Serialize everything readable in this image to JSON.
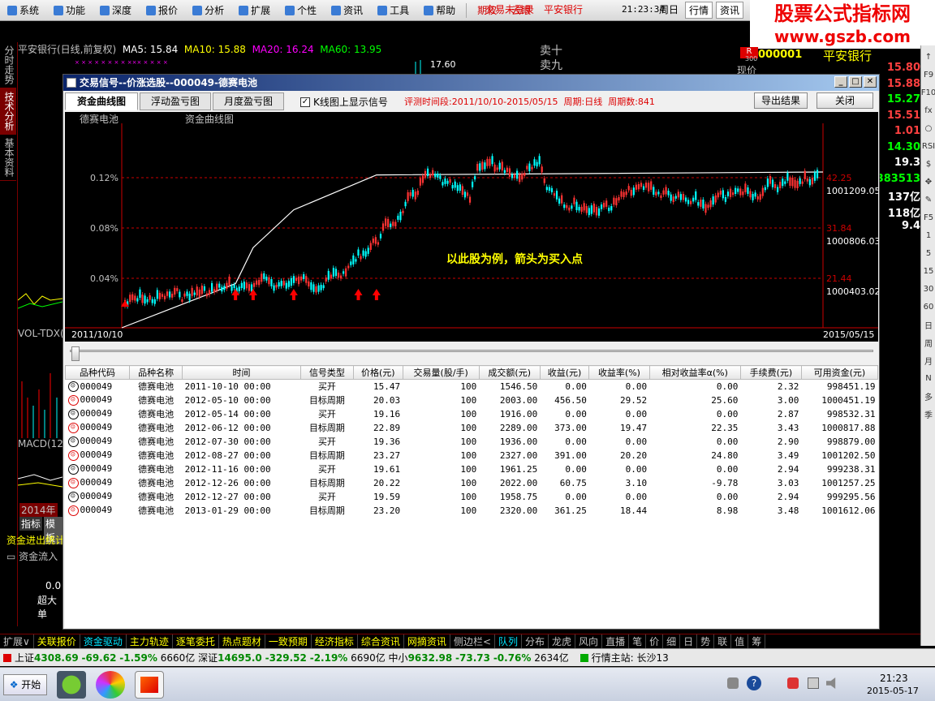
{
  "menu": {
    "items": [
      "系统",
      "功能",
      "深度",
      "报价",
      "分析",
      "扩展",
      "个性",
      "资讯",
      "工具",
      "帮助"
    ],
    "extra": [
      "期权",
      "云眼"
    ],
    "login": "交易未登录",
    "stock": "平安银行",
    "time": "21:23:34",
    "weekday": "周日",
    "btn1": "行情",
    "btn2": "资讯"
  },
  "logo": {
    "line1": "股票公式指标网",
    "line2": "www.gszb.com"
  },
  "left_tabs": [
    "分时走势",
    "技术分析",
    "基本资料"
  ],
  "bg": {
    "stock_line": "平安银行(日线,前复权)",
    "ma5": "MA5: 15.84",
    "ma10": "MA10: 15.88",
    "ma20": "MA20: 16.24",
    "ma60": "MA60: 13.95",
    "price_tag": "17.60",
    "sell10": "卖十",
    "sell9": "卖九",
    "vol_label": "VOL-TDX(",
    "macd_label": "MACD(12",
    "year_label": "2014年",
    "btab1": "指标",
    "btab2": "模板",
    "flow_title": "资金进出统计",
    "flow_sub": "资金流入",
    "flow_val": "0.0",
    "flow_cat": "超大单"
  },
  "right_panel": {
    "code_prefix": "R",
    "code_sub": "300",
    "code": "000001",
    "name": "平安银行",
    "row_top": "现价",
    "values": [
      "15.80",
      "15.88",
      "15.27",
      "15.51",
      "1.01",
      "14.30",
      "19.3",
      "383513",
      "137亿",
      "118亿",
      "9.4"
    ]
  },
  "right_toolbar": [
    "↑",
    "F9",
    "F10",
    "fx",
    "○",
    "RSI",
    "$",
    "✥",
    "✎",
    "F5",
    "1",
    "5",
    "15",
    "30",
    "60",
    "日",
    "周",
    "月",
    "N",
    "多",
    "季"
  ],
  "dialog": {
    "title": "交易信号--价涨选股--000049-德赛电池",
    "tabs": [
      "资金曲线图",
      "浮动盈亏图",
      "月度盈亏图"
    ],
    "checkbox_label": "K线图上显示信号",
    "eval_period": "评测时间段:2011/10/10-2015/05/15",
    "period": "周期:日线",
    "period_count": "周期数:841",
    "export_btn": "导出结果",
    "close_btn": "关闭"
  },
  "chart_data": {
    "type": "line",
    "stock_label": "德赛电池",
    "chart_label": "资金曲线图",
    "annotation": "以此股为例，箭头为买入点",
    "x_start": "2011/10/10",
    "x_end": "2015/05/15",
    "left_ticks": [
      "0.12%",
      "0.08%",
      "0.04%"
    ],
    "right_price_ticks": [
      "42.25",
      "31.84",
      "21.44"
    ],
    "right_fund_ticks": [
      "1001209.05",
      "1000806.03",
      "1000403.02"
    ],
    "equity_curve": {
      "name": "资金曲线",
      "x": [
        "2011/10/10",
        "2012/05/10",
        "2012/06/12",
        "2012/08/27",
        "2013/01/29",
        "2015/05/15"
      ],
      "y": [
        1000000,
        1000456.5,
        1000829.5,
        1001220.5,
        1001581.75,
        1001612.06
      ]
    },
    "buy_arrows": [
      "2012/05/10",
      "2012/06/12",
      "2012/08/27",
      "2012/12/26",
      "2013/01/29"
    ]
  },
  "table": {
    "headers": [
      "品种代码",
      "品种名称",
      "时间",
      "信号类型",
      "价格(元)",
      "交易量(股/手)",
      "成交额(元)",
      "收益(元)",
      "收益率(%)",
      "相对收益率α(%)",
      "手续费(元)",
      "可用资金(元)"
    ],
    "rows": [
      {
        "code": "000049",
        "name": "德赛电池",
        "time": "2011-10-10 00:00",
        "type": "买开",
        "price": "15.47",
        "vol": "100",
        "amount": "1546.50",
        "gain": "0.00",
        "rate": "0.00",
        "alpha": "0.00",
        "fee": "2.32",
        "funds": "998451.19",
        "icon": "buy"
      },
      {
        "code": "000049",
        "name": "德赛电池",
        "time": "2012-05-10 00:00",
        "type": "目标周期",
        "price": "20.03",
        "vol": "100",
        "amount": "2003.00",
        "gain": "456.50",
        "rate": "29.52",
        "alpha": "25.60",
        "fee": "3.00",
        "funds": "1000451.19",
        "icon": "sell"
      },
      {
        "code": "000049",
        "name": "德赛电池",
        "time": "2012-05-14 00:00",
        "type": "买开",
        "price": "19.16",
        "vol": "100",
        "amount": "1916.00",
        "gain": "0.00",
        "rate": "0.00",
        "alpha": "0.00",
        "fee": "2.87",
        "funds": "998532.31",
        "icon": "buy"
      },
      {
        "code": "000049",
        "name": "德赛电池",
        "time": "2012-06-12 00:00",
        "type": "目标周期",
        "price": "22.89",
        "vol": "100",
        "amount": "2289.00",
        "gain": "373.00",
        "rate": "19.47",
        "alpha": "22.35",
        "fee": "3.43",
        "funds": "1000817.88",
        "icon": "sell"
      },
      {
        "code": "000049",
        "name": "德赛电池",
        "time": "2012-07-30 00:00",
        "type": "买开",
        "price": "19.36",
        "vol": "100",
        "amount": "1936.00",
        "gain": "0.00",
        "rate": "0.00",
        "alpha": "0.00",
        "fee": "2.90",
        "funds": "998879.00",
        "icon": "buy"
      },
      {
        "code": "000049",
        "name": "德赛电池",
        "time": "2012-08-27 00:00",
        "type": "目标周期",
        "price": "23.27",
        "vol": "100",
        "amount": "2327.00",
        "gain": "391.00",
        "rate": "20.20",
        "alpha": "24.80",
        "fee": "3.49",
        "funds": "1001202.50",
        "icon": "sell"
      },
      {
        "code": "000049",
        "name": "德赛电池",
        "time": "2012-11-16 00:00",
        "type": "买开",
        "price": "19.61",
        "vol": "100",
        "amount": "1961.25",
        "gain": "0.00",
        "rate": "0.00",
        "alpha": "0.00",
        "fee": "2.94",
        "funds": "999238.31",
        "icon": "buy"
      },
      {
        "code": "000049",
        "name": "德赛电池",
        "time": "2012-12-26 00:00",
        "type": "目标周期",
        "price": "20.22",
        "vol": "100",
        "amount": "2022.00",
        "gain": "60.75",
        "rate": "3.10",
        "alpha": "-9.78",
        "fee": "3.03",
        "funds": "1001257.25",
        "icon": "sell"
      },
      {
        "code": "000049",
        "name": "德赛电池",
        "time": "2012-12-27 00:00",
        "type": "买开",
        "price": "19.59",
        "vol": "100",
        "amount": "1958.75",
        "gain": "0.00",
        "rate": "0.00",
        "alpha": "0.00",
        "fee": "2.94",
        "funds": "999295.56",
        "icon": "buy"
      },
      {
        "code": "000049",
        "name": "德赛电池",
        "time": "2013-01-29 00:00",
        "type": "目标周期",
        "price": "23.20",
        "vol": "100",
        "amount": "2320.00",
        "gain": "361.25",
        "rate": "18.44",
        "alpha": "8.98",
        "fee": "3.48",
        "funds": "1001612.06",
        "icon": "sell"
      }
    ]
  },
  "bottom_tabs": [
    "扩展∨",
    "关联报价",
    "资金驱动",
    "主力轨迹",
    "逐笔委托",
    "热点题材",
    "一致预期",
    "经济指标",
    "综合资讯",
    "网摘资讯",
    "侧边栏<",
    "队列",
    "分布",
    "龙虎",
    "风向",
    "直播",
    "笔",
    "价",
    "细",
    "日",
    "势",
    "联",
    "值",
    "筹"
  ],
  "status": {
    "sh_label": "上证",
    "sh": "4308.69",
    "sh_chg": "-69.62",
    "sh_pct": "-1.59%",
    "sh_amt": "6660亿",
    "sz_label": "深证",
    "sz": "14695.0",
    "sz_chg": "-329.52",
    "sz_pct": "-2.19%",
    "sz_amt": "6690亿",
    "zx_label": "中小",
    "zx": "9632.98",
    "zx_chg": "-73.73",
    "zx_pct": "-0.76%",
    "zx_amt": "2634亿",
    "server": "行情主站: 长沙13"
  },
  "taskbar": {
    "start": "开始",
    "time": "21:23",
    "date": "2015-05-17"
  }
}
